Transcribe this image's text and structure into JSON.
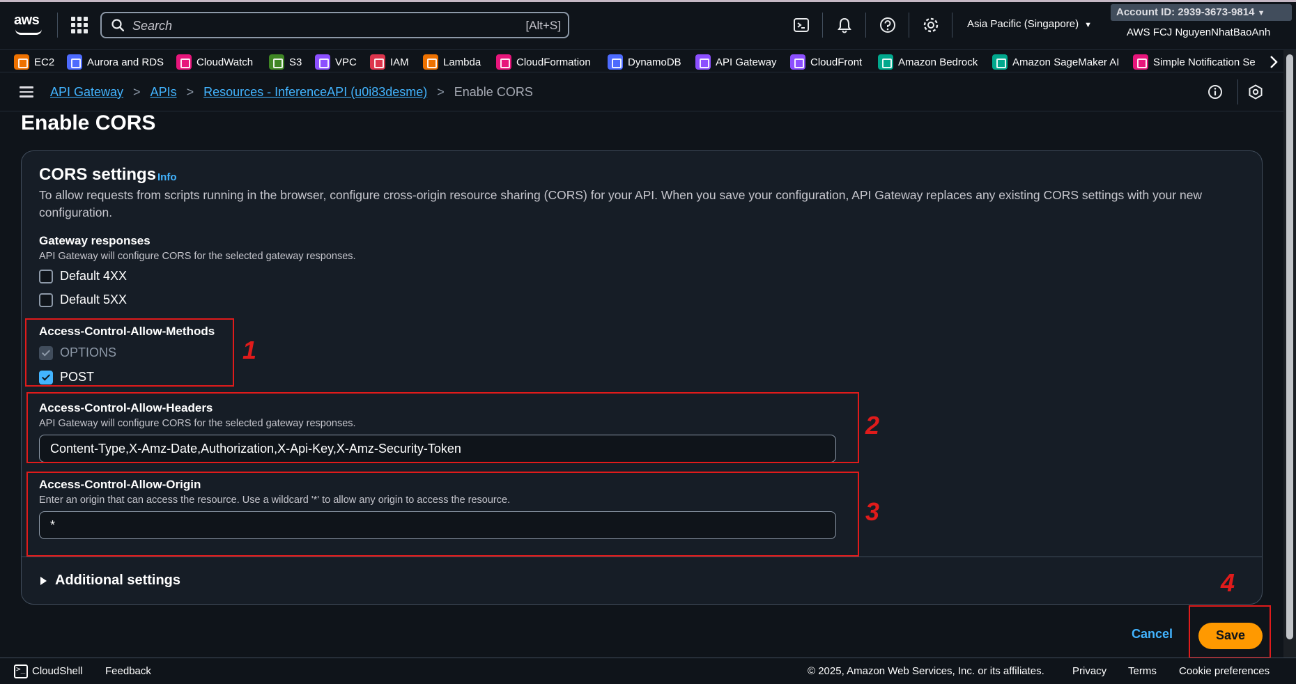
{
  "topnav": {
    "logo_text": "aws",
    "search_placeholder": "Search",
    "search_shortcut": "[Alt+S]",
    "region": "Asia Pacific (Singapore)",
    "account_id": "Account ID: 2939-3673-9814",
    "username": "AWS FCJ NguyenNhatBaoAnh",
    "icons": [
      "apps-icon",
      "cloudshell-icon",
      "bell-icon",
      "help-icon",
      "gear-icon"
    ]
  },
  "favorites": [
    {
      "label": "EC2",
      "color": "#ed7100"
    },
    {
      "label": "Aurora and RDS",
      "color": "#4d6bfe"
    },
    {
      "label": "CloudWatch",
      "color": "#e7157b"
    },
    {
      "label": "S3",
      "color": "#3f8624"
    },
    {
      "label": "VPC",
      "color": "#8c4fff"
    },
    {
      "label": "IAM",
      "color": "#dd344c"
    },
    {
      "label": "Lambda",
      "color": "#ed7100"
    },
    {
      "label": "CloudFormation",
      "color": "#e7157b"
    },
    {
      "label": "DynamoDB",
      "color": "#4d6bfe"
    },
    {
      "label": "API Gateway",
      "color": "#8c4fff"
    },
    {
      "label": "CloudFront",
      "color": "#8c4fff"
    },
    {
      "label": "Amazon Bedrock",
      "color": "#01a88d"
    },
    {
      "label": "Amazon SageMaker AI",
      "color": "#01a88d"
    },
    {
      "label": "Simple Notification Se",
      "color": "#e7157b"
    }
  ],
  "breadcrumb": {
    "items": [
      "API Gateway",
      "APIs",
      "Resources - InferenceAPI (u0i83desme)"
    ],
    "current": "Enable CORS"
  },
  "page": {
    "title": "Enable CORS"
  },
  "cors": {
    "title": "CORS settings",
    "info_link": "Info",
    "description": "To allow requests from scripts running in the browser, configure cross-origin resource sharing (CORS) for your API. When you save your configuration, API Gateway replaces any existing CORS settings with your new configuration.",
    "gateway_responses": {
      "label": "Gateway responses",
      "description": "API Gateway will configure CORS for the selected gateway responses.",
      "options": [
        {
          "label": "Default 4XX",
          "checked": false
        },
        {
          "label": "Default 5XX",
          "checked": false
        }
      ]
    },
    "allow_methods": {
      "label": "Access-Control-Allow-Methods",
      "options": [
        {
          "label": "OPTIONS",
          "checked": true,
          "disabled": true
        },
        {
          "label": "POST",
          "checked": true,
          "disabled": false
        }
      ]
    },
    "allow_headers": {
      "label": "Access-Control-Allow-Headers",
      "description": "API Gateway will configure CORS for the selected gateway responses.",
      "value": "Content-Type,X-Amz-Date,Authorization,X-Api-Key,X-Amz-Security-Token"
    },
    "allow_origin": {
      "label": "Access-Control-Allow-Origin",
      "description": "Enter an origin that can access the resource. Use a wildcard '*' to allow any origin to access the resource.",
      "value": "*"
    },
    "additional_settings": "Additional settings"
  },
  "actions": {
    "cancel": "Cancel",
    "save": "Save"
  },
  "annotations": [
    "1",
    "2",
    "3",
    "4"
  ],
  "footer": {
    "cloudshell": "CloudShell",
    "feedback": "Feedback",
    "copyright": "© 2025, Amazon Web Services, Inc. or its affiliates.",
    "privacy": "Privacy",
    "terms": "Terms",
    "cookies": "Cookie preferences"
  },
  "colors": {
    "accent_link": "#42b4ff",
    "primary_button": "#ff9900",
    "annotation_red": "#e01b1b",
    "background": "#0f141a",
    "card": "#161d26"
  }
}
